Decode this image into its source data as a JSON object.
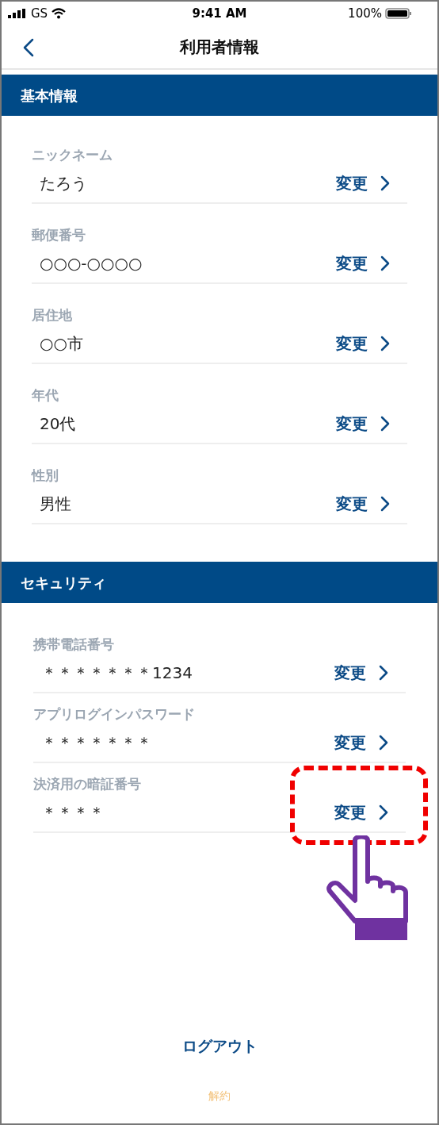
{
  "status_bar": {
    "carrier": "GS",
    "time": "9:41 AM",
    "battery": "100%"
  },
  "nav": {
    "title": "利用者情報"
  },
  "sections": [
    {
      "title": "基本情報",
      "kind": "basic",
      "items": [
        {
          "label": "ニックネーム",
          "value": "たろう",
          "action": "変更",
          "highlighted": false
        },
        {
          "label": "郵便番号",
          "value": "○○○-○○○○",
          "action": "変更",
          "highlighted": false
        },
        {
          "label": "居住地",
          "value": "○○市",
          "action": "変更",
          "highlighted": false
        },
        {
          "label": "年代",
          "value": "20代",
          "action": "変更",
          "highlighted": false
        },
        {
          "label": "性別",
          "value": "男性",
          "action": "変更",
          "highlighted": false
        }
      ]
    },
    {
      "title": "セキュリティ",
      "kind": "security",
      "items": [
        {
          "label": "携帯電話番号",
          "value": "＊＊＊＊＊＊＊1234",
          "action": "変更",
          "highlighted": false
        },
        {
          "label": "アプリログインパスワード",
          "value": "＊＊＊＊＊＊＊",
          "action": "変更",
          "highlighted": false
        },
        {
          "label": "決済用の暗証番号",
          "value": "＊＊＊＊",
          "action": "変更",
          "highlighted": true
        }
      ]
    }
  ],
  "logout": "ログアウト",
  "cancel": "解約"
}
